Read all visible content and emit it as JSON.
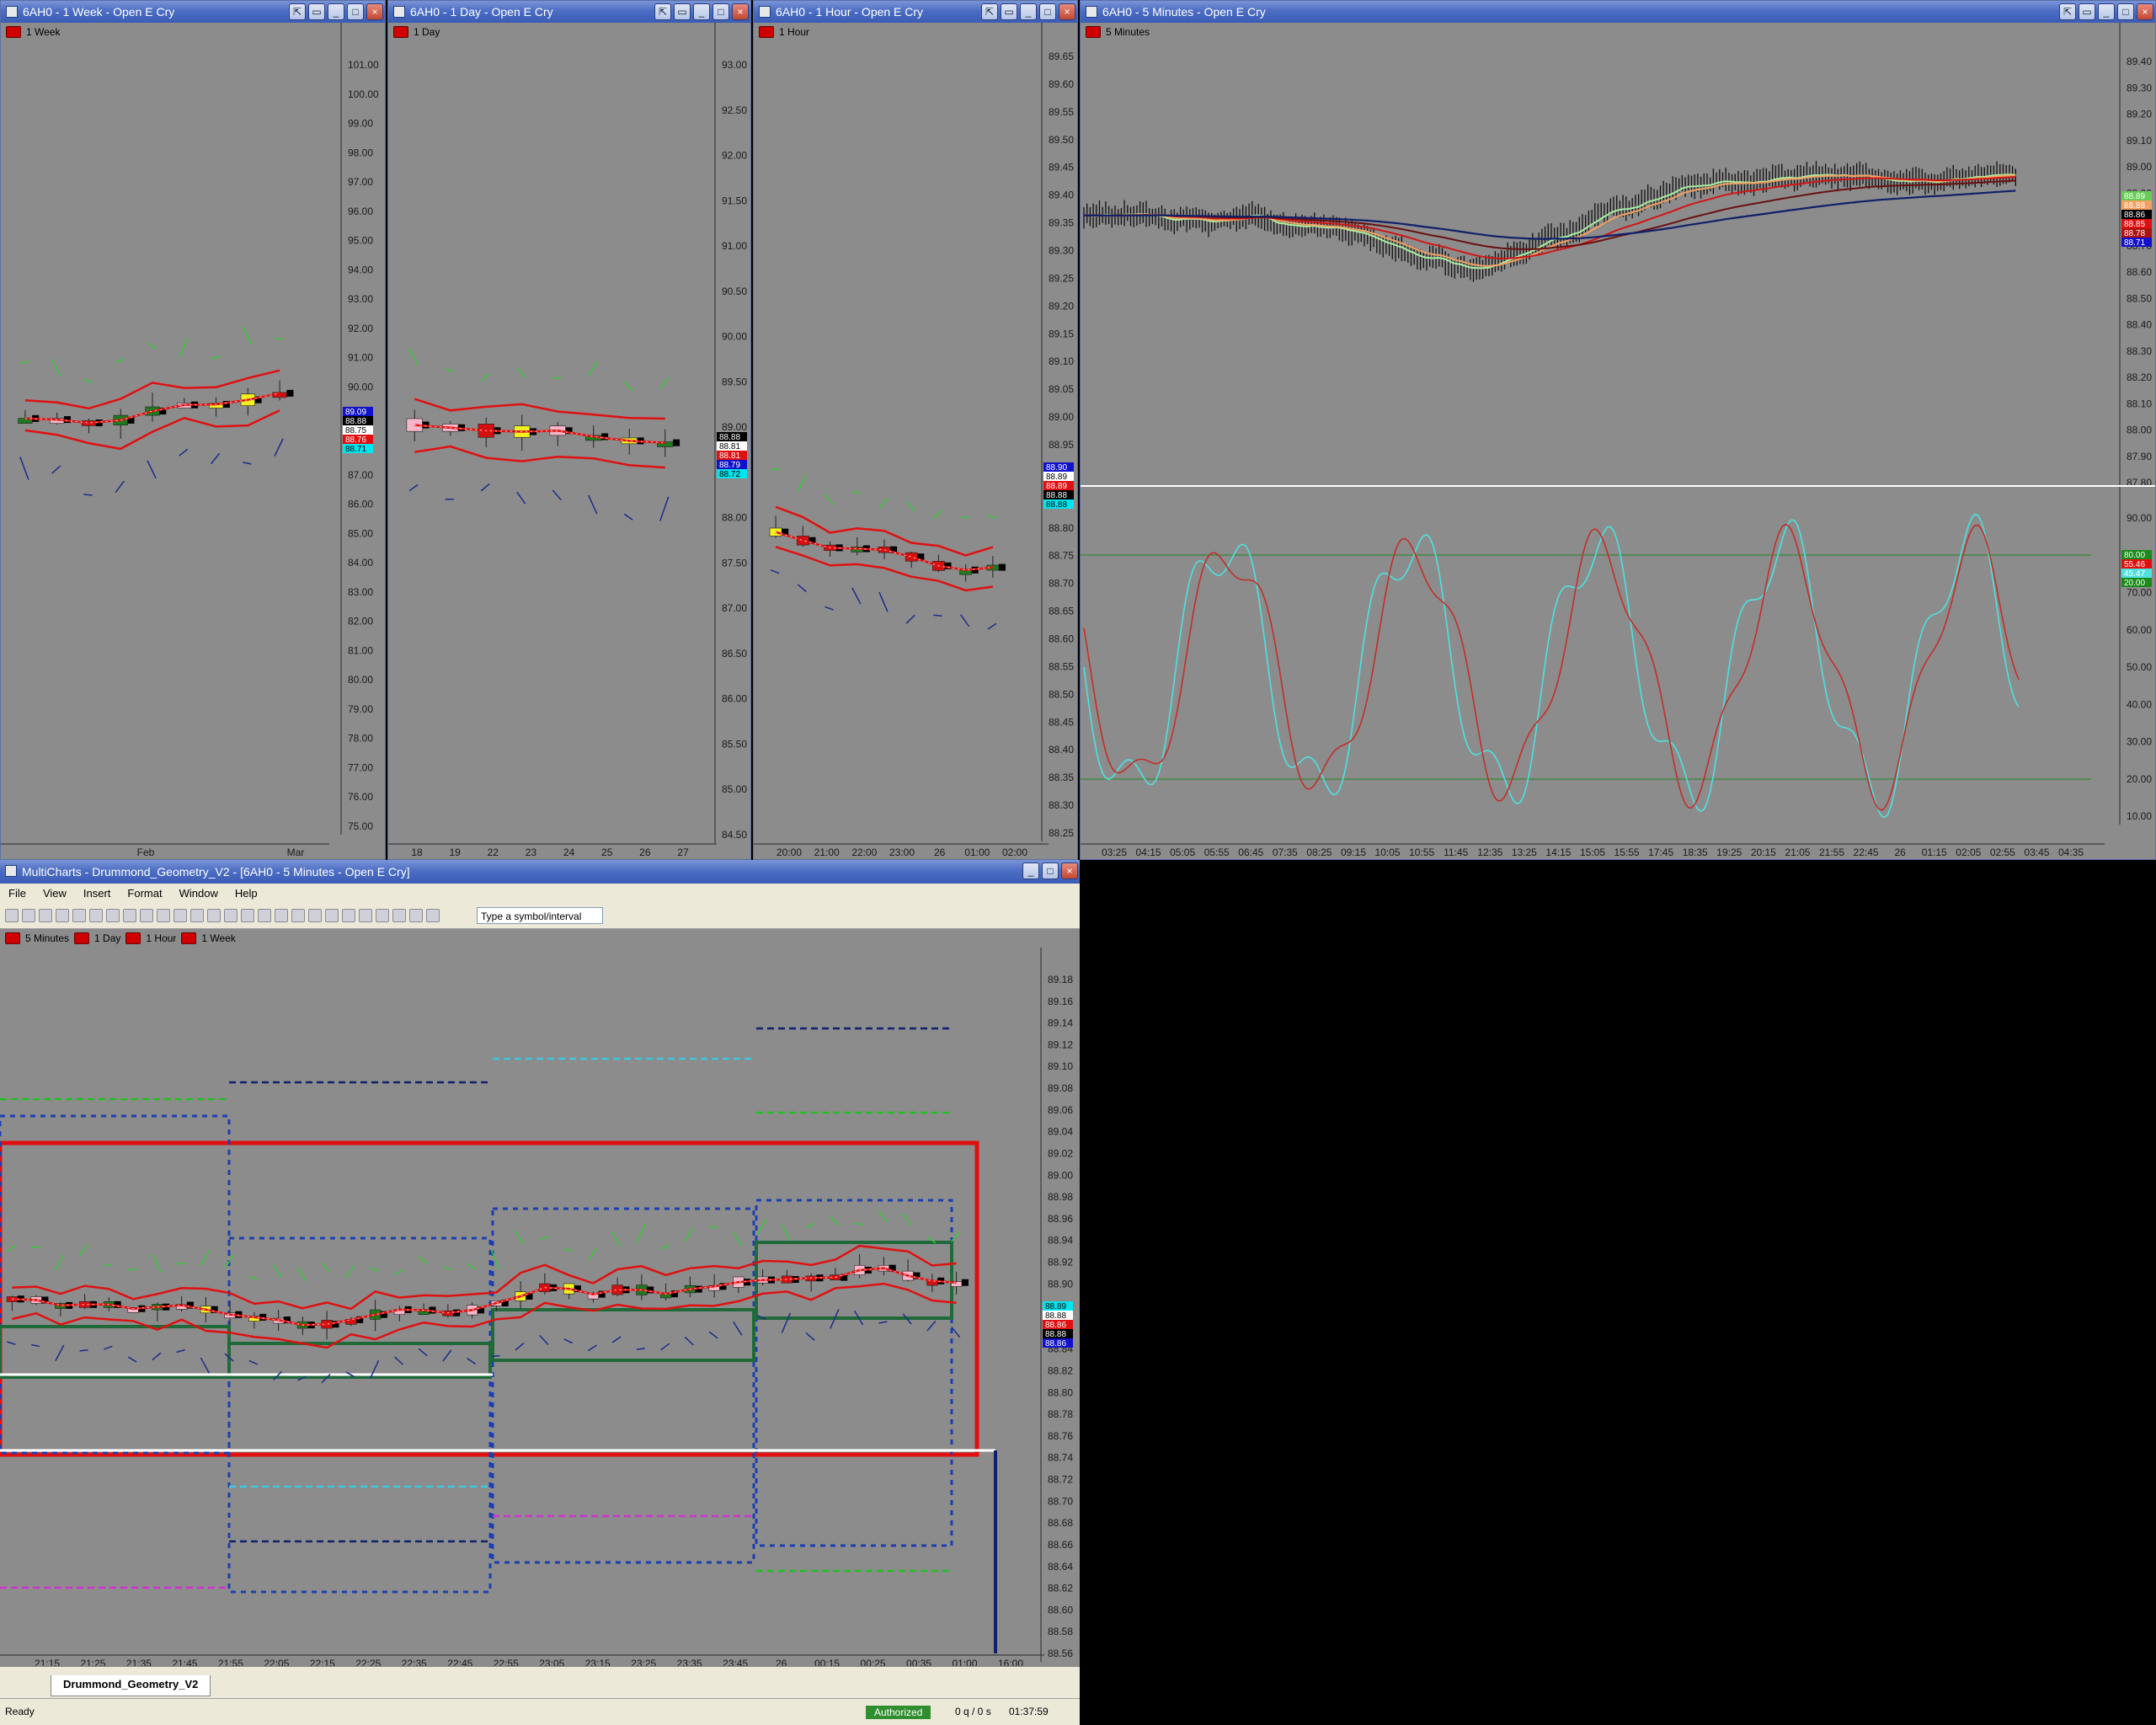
{
  "windows": {
    "week": {
      "title": "6AH0 - 1 Week - Open E Cry",
      "tag": "1 Week",
      "y_labels": [
        "101.00",
        "100.00",
        "99.00",
        "98.00",
        "97.00",
        "96.00",
        "95.00",
        "94.00",
        "93.00",
        "92.00",
        "91.00",
        "90.00",
        "89.00",
        "88.00",
        "87.00",
        "86.00",
        "85.00",
        "84.00",
        "83.00",
        "82.00",
        "81.00",
        "80.00",
        "79.00",
        "78.00",
        "77.00",
        "76.00",
        "75.00"
      ],
      "x_labels": [
        "Feb",
        "Mar"
      ],
      "price_tags": [
        "89.09",
        "88.88",
        "88.75",
        "88.76",
        "88.71"
      ]
    },
    "day": {
      "title": "6AH0 - 1 Day - Open E Cry",
      "tag": "1 Day",
      "y_labels": [
        "93.00",
        "92.50",
        "92.00",
        "91.50",
        "91.00",
        "90.50",
        "90.00",
        "89.50",
        "89.00",
        "88.50",
        "88.00",
        "87.50",
        "87.00",
        "86.50",
        "86.00",
        "85.50",
        "85.00",
        "84.50"
      ],
      "x_labels": [
        "18",
        "19",
        "22",
        "23",
        "24",
        "25",
        "26",
        "27"
      ],
      "price_tags": [
        "88.88",
        "88.81",
        "88.81",
        "88.79",
        "88.72"
      ]
    },
    "hour": {
      "title": "6AH0 - 1 Hour - Open E Cry",
      "tag": "1 Hour",
      "y_labels": [
        "89.65",
        "89.60",
        "89.55",
        "89.50",
        "89.45",
        "89.40",
        "89.35",
        "89.30",
        "89.25",
        "89.20",
        "89.15",
        "89.10",
        "89.05",
        "89.00",
        "88.95",
        "88.90",
        "88.85",
        "88.80",
        "88.75",
        "88.70",
        "88.65",
        "88.60",
        "88.55",
        "88.50",
        "88.45",
        "88.40",
        "88.35",
        "88.30",
        "88.25"
      ],
      "x_labels": [
        "20:00",
        "21:00",
        "22:00",
        "23:00",
        "26",
        "01:00",
        "02:00"
      ],
      "price_tags": [
        "88.90",
        "88.89",
        "88.89",
        "88.88",
        "88.88"
      ]
    },
    "min5": {
      "title": "6AH0 - 5 Minutes - Open E Cry",
      "tag": "5 Minutes",
      "y_labels": [
        "89.40",
        "89.30",
        "89.20",
        "89.10",
        "89.00",
        "88.90",
        "88.80",
        "88.70",
        "88.60",
        "88.50",
        "88.40",
        "88.30",
        "88.20",
        "88.10",
        "88.00",
        "87.90",
        "87.80"
      ],
      "osc_labels": [
        "90.00",
        "80.00",
        "70.00",
        "60.00",
        "50.00",
        "40.00",
        "30.00",
        "20.00",
        "10.00"
      ],
      "x_labels": [
        "03:25",
        "04:15",
        "05:05",
        "05:55",
        "06:45",
        "07:35",
        "08:25",
        "09:15",
        "10:05",
        "10:55",
        "11:45",
        "12:35",
        "13:25",
        "14:15",
        "15:05",
        "15:55",
        "17:45",
        "18:35",
        "19:25",
        "20:15",
        "21:05",
        "21:55",
        "22:45",
        "26",
        "01:15",
        "02:05",
        "02:55",
        "03:45",
        "04:35"
      ],
      "price_tags": [
        "88.89",
        "88.88",
        "88.86",
        "88.85",
        "88.78",
        "88.71"
      ],
      "osc_tags": [
        "80.00",
        "55.46",
        "45.47",
        "20.00"
      ]
    }
  },
  "main": {
    "title": "MultiCharts - Drummond_Geometry_V2 - [6AH0 - 5 Minutes - Open E Cry]",
    "menu": [
      "File",
      "View",
      "Insert",
      "Format",
      "Window",
      "Help"
    ],
    "symbol_placeholder": "Type a symbol/interval",
    "legend": [
      "5 Minutes",
      "1 Day",
      "1 Hour",
      "1 Week"
    ],
    "y_labels": [
      "89.18",
      "89.16",
      "89.14",
      "89.12",
      "89.10",
      "89.08",
      "89.06",
      "89.04",
      "89.02",
      "89.00",
      "88.98",
      "88.96",
      "88.94",
      "88.92",
      "88.90",
      "88.88",
      "88.86",
      "88.84",
      "88.82",
      "88.80",
      "88.78",
      "88.76",
      "88.74",
      "88.72",
      "88.70",
      "88.68",
      "88.66",
      "88.64",
      "88.62",
      "88.60",
      "88.58",
      "88.56"
    ],
    "x_labels": [
      "21:15",
      "21:25",
      "21:35",
      "21:45",
      "21:55",
      "22:05",
      "22:15",
      "22:25",
      "22:35",
      "22:45",
      "22:55",
      "23:05",
      "23:15",
      "23:25",
      "23:35",
      "23:45",
      "26",
      "00:15",
      "00:25",
      "00:35",
      "01:00",
      "16:00"
    ],
    "price_tags": [
      "88.89",
      "88.88",
      "88.86",
      "88.88",
      "88.86"
    ],
    "tab": "Drummond_Geometry_V2",
    "status": {
      "ready": "Ready",
      "auth": "Authorized",
      "queue": "0 q / 0 s",
      "time": "01:37:59"
    }
  },
  "colors": {
    "up": "#1f7a1f",
    "down": "#d11010",
    "yellow": "#f3f020",
    "pink": "#f4b6c8",
    "bg": "#8c8c8c",
    "ma": "#e01010"
  }
}
